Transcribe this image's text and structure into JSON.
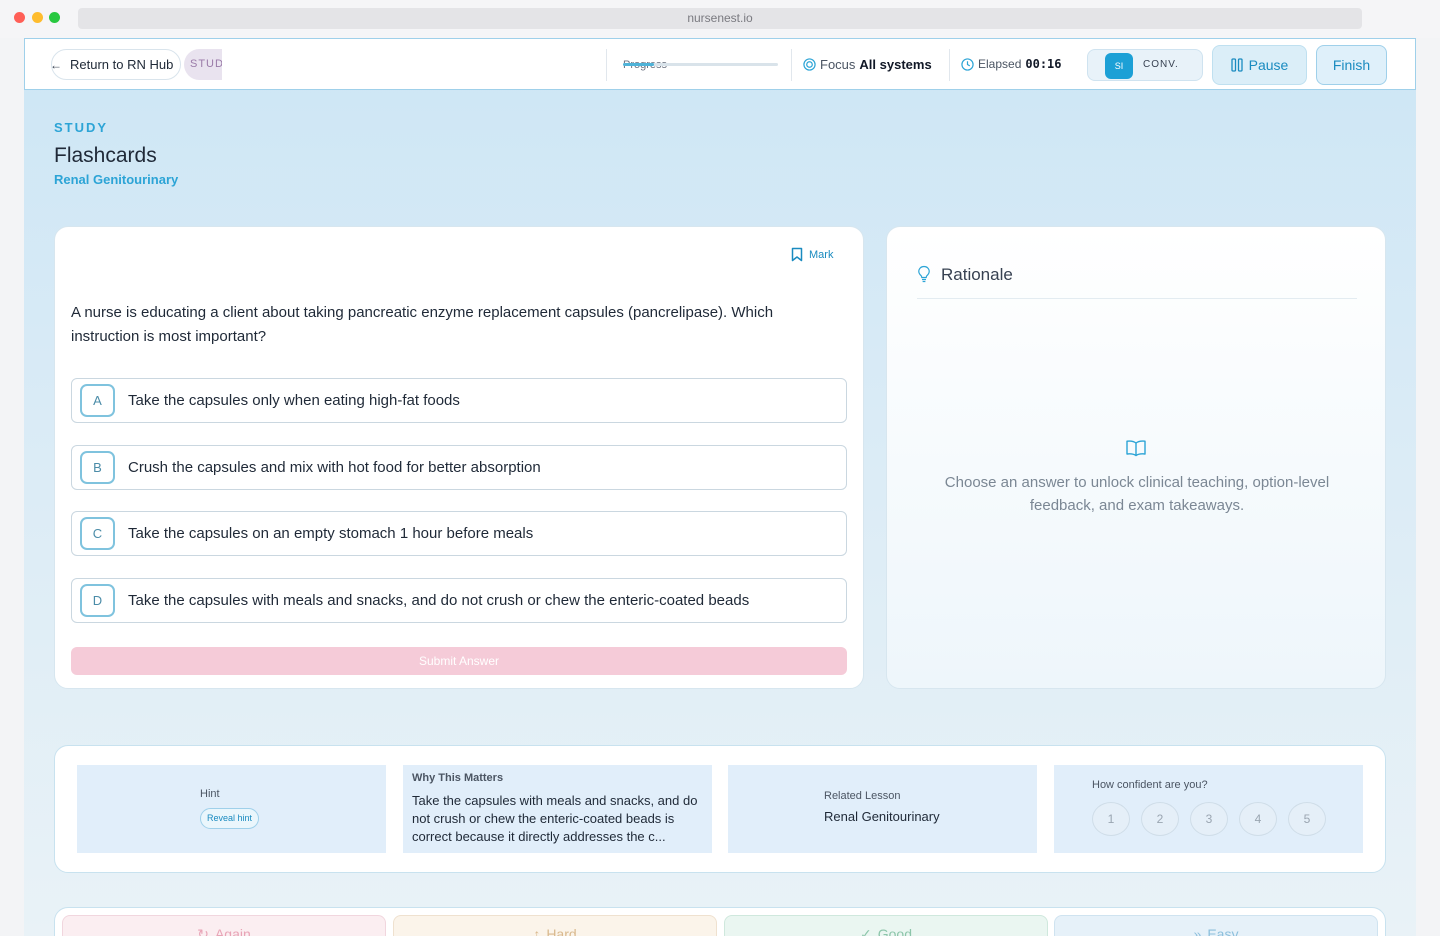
{
  "browser": {
    "url": "nursenest.io"
  },
  "topbar": {
    "return_label": "Return to RN Hub",
    "study_pill": "STUDY",
    "progress_label": "Progress",
    "progress_fraction": 0.2,
    "focus_label": "Focus",
    "focus_value": "All systems",
    "elapsed_label": "Elapsed",
    "elapsed_value": "00:16",
    "mode_active": "SI",
    "mode_other": "CONV.",
    "pause_label": "Pause",
    "finish_label": "Finish"
  },
  "header": {
    "eyebrow": "STUDY",
    "title": "Flashcards",
    "subtitle": "Renal Genitourinary"
  },
  "question_card": {
    "mark_label": "Mark",
    "question": "A nurse is educating a client about taking pancreatic enzyme replacement capsules (pancrelipase). Which instruction is most important?",
    "options": [
      {
        "letter": "A",
        "text": "Take the capsules only when eating high-fat foods"
      },
      {
        "letter": "B",
        "text": "Crush the capsules and mix with hot food for better absorption"
      },
      {
        "letter": "C",
        "text": "Take the capsules on an empty stomach 1 hour before meals"
      },
      {
        "letter": "D",
        "text": "Take the capsules with meals and snacks, and do not crush or chew the enteric-coated beads"
      }
    ],
    "submit_label": "Submit Answer"
  },
  "rationale": {
    "title": "Rationale",
    "placeholder": "Choose an answer to unlock clinical teaching, option-level feedback, and exam takeaways."
  },
  "info_strip": {
    "hint_label": "Hint",
    "hint_button": "Reveal hint",
    "why_label": "Why This Matters",
    "why_text": "Take the capsules with meals and snacks, and do not crush or chew the enteric-coated beads is correct because it directly addresses the c...",
    "related_label": "Related Lesson",
    "related_value": "Renal Genitourinary",
    "confidence_label": "How confident are you?",
    "confidence_levels": [
      "1",
      "2",
      "3",
      "4",
      "5"
    ]
  },
  "ratings": {
    "again": "Again",
    "hard": "Hard",
    "good": "Good",
    "easy": "Easy"
  },
  "icons": {
    "focus": "target-icon",
    "elapsed": "clock-icon",
    "pause": "pause-icon",
    "mark": "bookmark-icon",
    "rationale": "lightbulb-icon",
    "rationale_empty": "open-book-icon",
    "again": "refresh-icon",
    "hard": "thumbs-up-icon",
    "good": "check-circle-icon",
    "easy": "double-chevron-icon"
  },
  "colors": {
    "accent": "#2ca4d6",
    "submit_disabled": "#f5cbd8"
  }
}
